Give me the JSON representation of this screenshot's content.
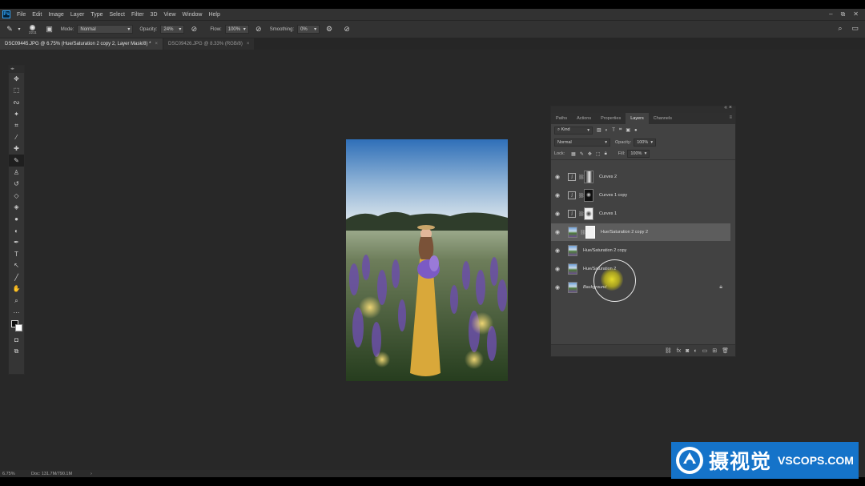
{
  "app": {
    "logo_text": "Ps",
    "menu": [
      "File",
      "Edit",
      "Image",
      "Layer",
      "Type",
      "Select",
      "Filter",
      "3D",
      "View",
      "Window",
      "Help"
    ],
    "window_controls": [
      "–",
      "⧉",
      "✕"
    ]
  },
  "options": {
    "brush_size": "2211",
    "mode_label": "Mode:",
    "mode_value": "Normal",
    "opacity_label": "Opacity:",
    "opacity_value": "24%",
    "flow_label": "Flow:",
    "flow_value": "100%",
    "smoothing_label": "Smoothing:",
    "smoothing_value": "0%"
  },
  "tabs": [
    {
      "label": "DSC09445.JPG @ 6.75% (Hue/Saturation 2 copy 2, Layer Mask/8) *",
      "active": true
    },
    {
      "label": "DSC09426.JPG @ 8.33% (RGB/8)",
      "active": false
    }
  ],
  "tools": [
    "move-tool",
    "marquee-tool",
    "lasso-tool",
    "magic-wand-tool",
    "crop-tool",
    "eyedropper-tool",
    "healing-tool",
    "brush-tool",
    "stamp-tool",
    "history-brush-tool",
    "eraser-tool",
    "paint-bucket-tool",
    "blur-tool",
    "dodge-tool",
    "pen-tool",
    "type-tool",
    "path-selection-tool",
    "line-tool",
    "hand-tool",
    "zoom-tool",
    "more-tools"
  ],
  "tool_glyphs": [
    "✥",
    "⬚",
    "ᔓ",
    "✦",
    "⌗",
    "⁄",
    "✚",
    "✎",
    "♙",
    "↺",
    "◇",
    "◈",
    "●",
    "◐",
    "✒",
    "T",
    "↖",
    "╱",
    "✋",
    "⌕",
    "⋯"
  ],
  "layers_panel": {
    "tabs": [
      "Paths",
      "Actions",
      "Properties",
      "Layers",
      "Channels"
    ],
    "active_tab": "Layers",
    "filter_kind": "Kind",
    "blend_mode": "Normal",
    "opacity_label": "Opacity:",
    "opacity_value": "100%",
    "lock_label": "Lock:",
    "fill_label": "Fill:",
    "fill_value": "100%",
    "layers": [
      {
        "name": "Curves 2",
        "kind": "adjustment",
        "mask": "dark"
      },
      {
        "name": "Curves 1 copy",
        "kind": "adjustment",
        "mask": "black"
      },
      {
        "name": "Curves 1",
        "kind": "adjustment",
        "mask": "white"
      },
      {
        "name": "Hue/Saturation 2 copy 2",
        "kind": "image-mask",
        "selected": true
      },
      {
        "name": "Hue/Saturation 2 copy",
        "kind": "image"
      },
      {
        "name": "Hue/Saturation 2",
        "kind": "image"
      },
      {
        "name": "Background",
        "kind": "image",
        "locked": true
      }
    ]
  },
  "status": {
    "zoom": "6.75%",
    "doc": "Doc: 131.7M/790.1M"
  },
  "watermark": {
    "cn": "摄视觉",
    "en": "VSCOPS.COM"
  }
}
